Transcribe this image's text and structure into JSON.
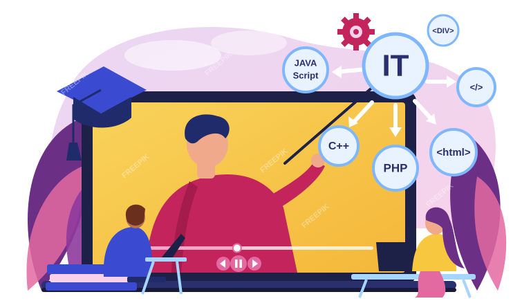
{
  "illustration": {
    "hub_label": "IT",
    "topics": {
      "javascript_line1": "JAVA",
      "javascript_line2": "Script",
      "div": "<DIV>",
      "closing_tag": "</>",
      "cpp": "C++",
      "php": "PHP",
      "html": "<html>"
    },
    "watermark": "FREEPIK",
    "colors": {
      "screen": "#f7c83f",
      "laptop_frame": "#1d2147",
      "leaf_purple": "#6b2f86",
      "leaf_pink": "#e36aa0",
      "node_fill": "#e8f3ff",
      "node_stroke": "#7fb7ff",
      "shirt": "#c2245b",
      "arrow": "#ffffff",
      "progress": "#f4a6c8"
    },
    "video": {
      "progress": 0.42
    }
  }
}
